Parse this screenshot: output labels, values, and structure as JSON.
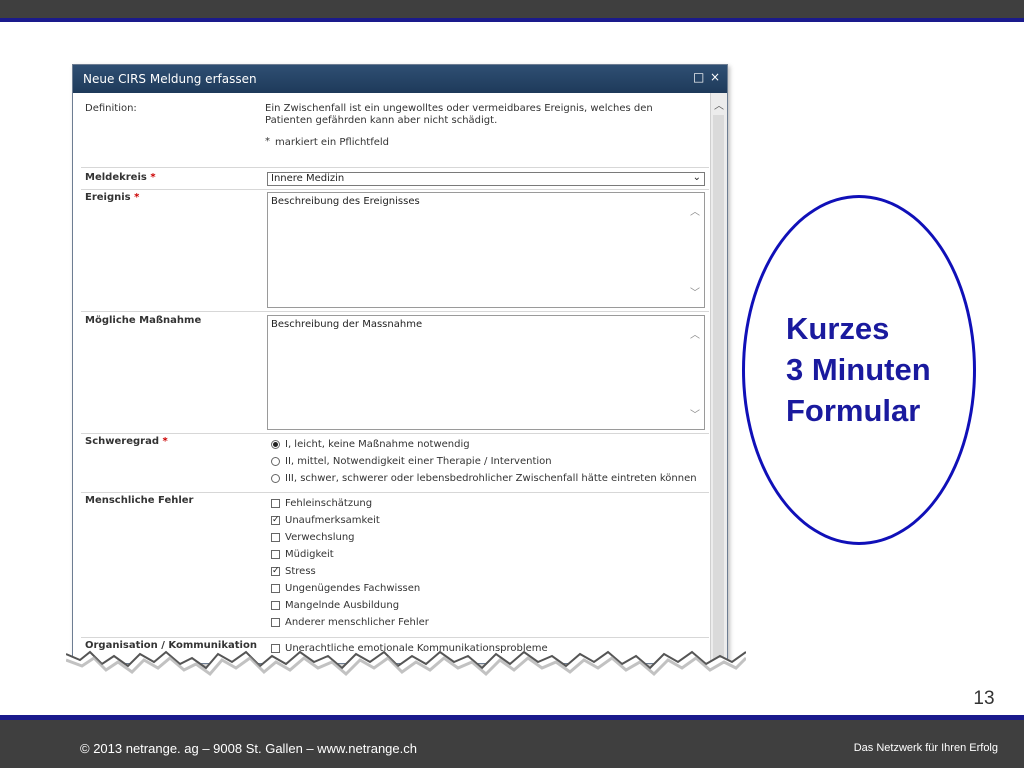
{
  "dialog": {
    "title": "Neue CIRS Meldung erfassen",
    "maximize_icon": "□",
    "close_icon": "×"
  },
  "form": {
    "definition": {
      "label": "Definition:",
      "text_line1": "Ein Zwischenfall ist ein ungewolltes oder vermeidbares Ereignis, welches den",
      "text_line2": "Patienten gefährden kann aber nicht schädigt.",
      "required_marker": "*",
      "required_note": "markiert ein Pflichtfeld"
    },
    "meldekreis": {
      "label": "Meldekreis",
      "req": "*",
      "value": "Innere Medizin"
    },
    "ereignis": {
      "label": "Ereignis",
      "req": "*",
      "value": "Beschreibung des Ereignisses"
    },
    "massnahme": {
      "label": "Mögliche Maßnahme",
      "value": "Beschreibung der Massnahme"
    },
    "schweregrad": {
      "label": "Schweregrad",
      "req": "*",
      "options": [
        {
          "text": "I, leicht, keine Maßnahme notwendig",
          "selected": true
        },
        {
          "text": "II, mittel, Notwendigkeit einer Therapie / Intervention",
          "selected": false
        },
        {
          "text": "III, schwer, schwerer oder lebensbedrohlicher Zwischenfall hätte eintreten können",
          "selected": false
        }
      ]
    },
    "menschliche_fehler": {
      "label": "Menschliche Fehler",
      "options": [
        {
          "text": "Fehleinschätzung",
          "checked": false
        },
        {
          "text": "Unaufmerksamkeit",
          "checked": true
        },
        {
          "text": "Verwechslung",
          "checked": false
        },
        {
          "text": "Müdigkeit",
          "checked": false
        },
        {
          "text": "Stress",
          "checked": true
        },
        {
          "text": "Ungenügendes Fachwissen",
          "checked": false
        },
        {
          "text": "Mangelnde Ausbildung",
          "checked": false
        },
        {
          "text": "Anderer menschlicher Fehler",
          "checked": false
        }
      ]
    },
    "organisation": {
      "label": "Organisation / Kommunikation",
      "first_option": "Unerachtliche emotionale Kommunikationsprobleme"
    }
  },
  "annotation": {
    "line1": "Kurzes",
    "line2": "3 Minuten",
    "line3": "Formular",
    "color": "#1a1a9e"
  },
  "page_number": "13",
  "footer": {
    "left": "© 2013 netrange. ag – 9008 St. Gallen – www.netrange.ch",
    "right": "Das Netzwerk für Ihren Erfolg"
  }
}
